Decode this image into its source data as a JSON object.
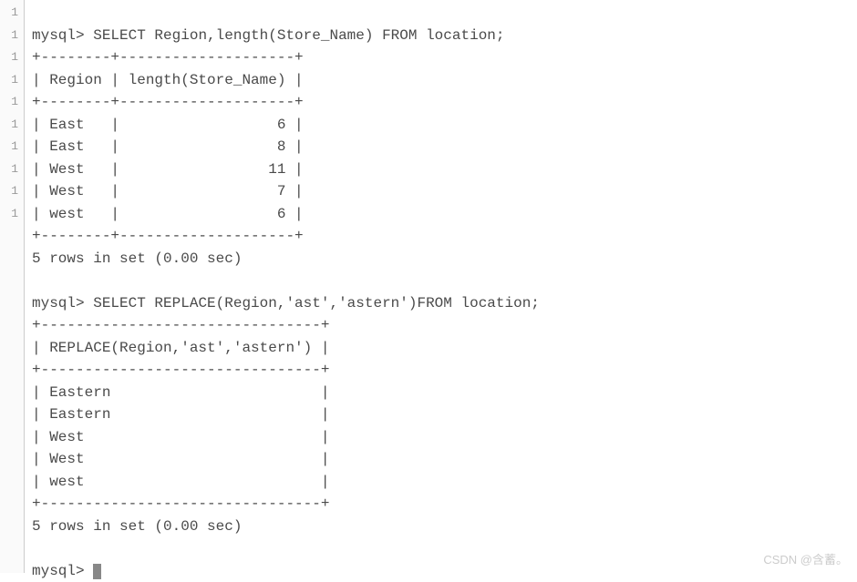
{
  "gutter": [
    "1",
    "1",
    "1",
    "1",
    "1",
    "1",
    "1",
    "1",
    "1",
    "1"
  ],
  "queries": [
    {
      "prompt": "mysql> ",
      "sql": "SELECT Region,length(Store_Name) FROM location;",
      "border_top": "+--------+--------------------+",
      "header_row": "| Region | length(Store_Name) |",
      "border_mid": "+--------+--------------------+",
      "rows": [
        "| East   |                  6 |",
        "| East   |                  8 |",
        "| West   |                 11 |",
        "| West   |                  7 |",
        "| west   |                  6 |"
      ],
      "border_bot": "+--------+--------------------+",
      "summary": "5 rows in set (0.00 sec)"
    },
    {
      "prompt": "mysql> ",
      "sql": "SELECT REPLACE(Region,'ast','astern')FROM location;",
      "border_top": "+--------------------------------+",
      "header_row": "| REPLACE(Region,'ast','astern') |",
      "border_mid": "+--------------------------------+",
      "rows": [
        "| Eastern                        |",
        "| Eastern                        |",
        "| West                           |",
        "| West                           |",
        "| west                           |"
      ],
      "border_bot": "+--------------------------------+",
      "summary": "5 rows in set (0.00 sec)"
    }
  ],
  "final_prompt": "mysql> ",
  "watermark": "CSDN @含蓄。"
}
